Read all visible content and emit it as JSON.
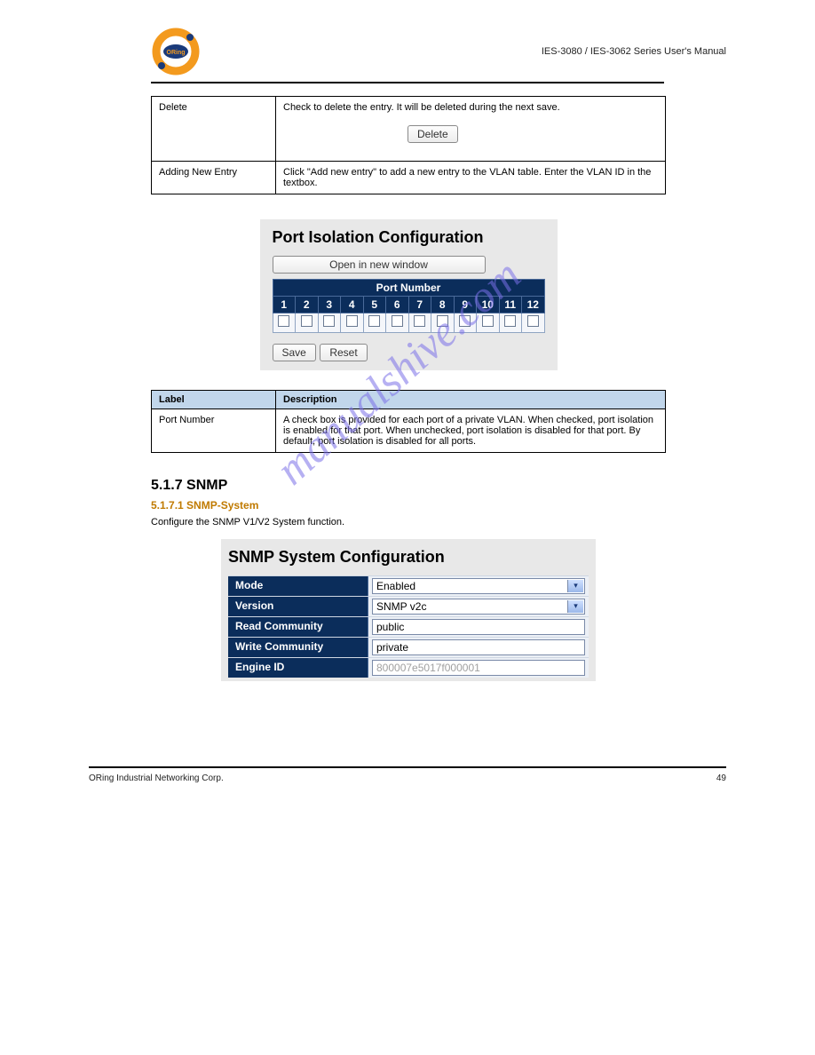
{
  "header": {
    "right_text": "IES-3080 / IES-3062 Series User's Manual"
  },
  "delete_table": {
    "row1_label": "Delete",
    "row1_desc_pre": "Check to delete the entry. It will be deleted during the next save.",
    "button_label": "Delete",
    "row2_label": "Adding New Entry",
    "row2_desc": "Click \"Add new entry\" to add a new entry to the VLAN table. Enter the VLAN ID in the textbox."
  },
  "port_isolation": {
    "title": "Port Isolation Configuration",
    "open_btn": "Open in new window",
    "port_hdr": "Port Number",
    "ports": [
      "1",
      "2",
      "3",
      "4",
      "5",
      "6",
      "7",
      "8",
      "9",
      "10",
      "11",
      "12"
    ],
    "save": "Save",
    "reset": "Reset"
  },
  "labels_table": {
    "hdr_label": "Label",
    "hdr_desc": "Description",
    "row_label": "Port Number",
    "row_desc": "A check box is provided for each port of a private VLAN. When checked, port isolation is enabled for that port. When unchecked, port isolation is disabled for that port. By default, port isolation is disabled for all ports."
  },
  "snmp_section": {
    "num": "5.1.7 SNMP",
    "sub": "5.1.7.1 SNMP-System",
    "para": "Configure the SNMP V1/V2 System function."
  },
  "snmp_panel": {
    "title": "SNMP System Configuration",
    "rows": {
      "mode_label": "Mode",
      "mode_value": "Enabled",
      "version_label": "Version",
      "version_value": "SNMP v2c",
      "read_label": "Read Community",
      "read_value": "public",
      "write_label": "Write Community",
      "write_value": "private",
      "engine_label": "Engine ID",
      "engine_value": "800007e5017f000001"
    }
  },
  "footer": {
    "left": "ORing Industrial Networking Corp.",
    "right": "49"
  }
}
